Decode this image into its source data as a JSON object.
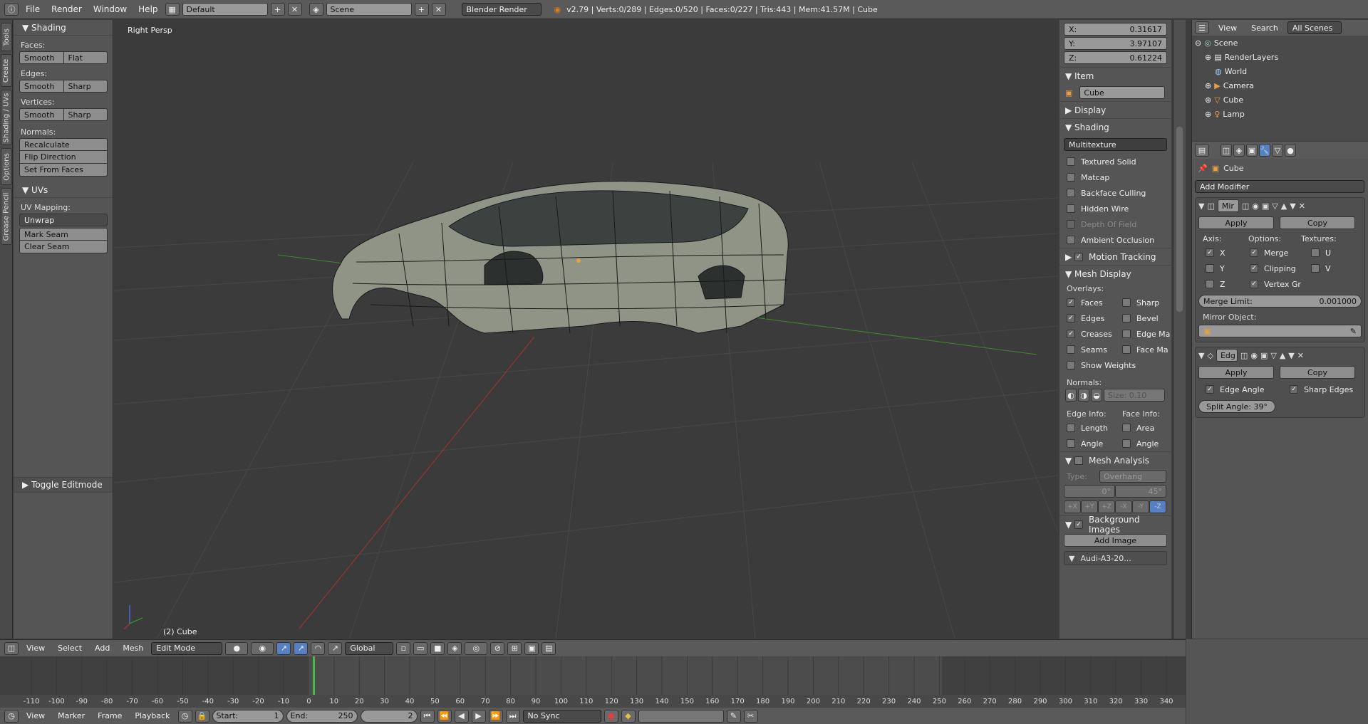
{
  "topbar": {
    "menus": [
      "File",
      "Render",
      "Window",
      "Help"
    ],
    "layout": "Default",
    "scene": "Scene",
    "engine": "Blender Render",
    "stats": "v2.79 | Verts:0/289 | Edges:0/520 | Faces:0/227 | Tris:443 | Mem:41.57M | Cube"
  },
  "tabs": [
    "Tools",
    "Create",
    "Shading / UVs",
    "Options",
    "Grease Pencil"
  ],
  "toolshelf": {
    "shading_title": "Shading",
    "faces_label": "Faces:",
    "faces_smooth": "Smooth",
    "faces_flat": "Flat",
    "edges_label": "Edges:",
    "edges_smooth": "Smooth",
    "edges_sharp": "Sharp",
    "vertices_label": "Vertices:",
    "vertices_smooth": "Smooth",
    "vertices_sharp": "Sharp",
    "normals_label": "Normals:",
    "recalculate": "Recalculate",
    "flip_direction": "Flip Direction",
    "set_from_faces": "Set From Faces",
    "uvs_title": "UVs",
    "uv_mapping_label": "UV Mapping:",
    "unwrap": "Unwrap",
    "mark_seam": "Mark Seam",
    "clear_seam": "Clear Seam",
    "toggle_editmode": "Toggle Editmode"
  },
  "viewport": {
    "view_name": "Right Persp",
    "object_label": "(2) Cube"
  },
  "npanel": {
    "x_label": "X:",
    "x_value": "0.31617",
    "y_label": "Y:",
    "y_value": "3.97107",
    "z_label": "Z:",
    "z_value": "0.61224",
    "item_title": "Item",
    "item_name": "Cube",
    "display_title": "Display",
    "shading_title": "Shading",
    "shading_mode": "Multitexture",
    "textured_solid": "Textured Solid",
    "matcap": "Matcap",
    "backface_culling": "Backface Culling",
    "hidden_wire": "Hidden Wire",
    "depth_of_field": "Depth Of Field",
    "ambient_occlusion": "Ambient Occlusion",
    "motion_tracking": "Motion Tracking",
    "mesh_display": "Mesh Display",
    "overlays_label": "Overlays:",
    "faces": "Faces",
    "sharp": "Sharp",
    "edges": "Edges",
    "bevel": "Bevel",
    "creases": "Creases",
    "edge_ma": "Edge Ma",
    "seams": "Seams",
    "face_ma": "Face Ma",
    "show_weights": "Show Weights",
    "normals_label": "Normals:",
    "size": "Size:  0.10",
    "edge_info": "Edge Info:",
    "face_info": "Face Info:",
    "length": "Length",
    "area": "Area",
    "angle_e": "Angle",
    "angle_f": "Angle",
    "mesh_analysis": "Mesh Analysis",
    "type_label": "Type:",
    "type_value": "Overhang",
    "deg_min": "0°",
    "deg_max": "45°",
    "axes": [
      "+X",
      "+Y",
      "+Z",
      "-X",
      "-Y",
      "-Z"
    ],
    "background_images": "Background Images",
    "add_image": "Add Image",
    "image_name": "Audi-A3-20..."
  },
  "outliner": {
    "menus": [
      "View",
      "Search"
    ],
    "filter": "All Scenes",
    "items": [
      "Scene",
      "RenderLayers",
      "World",
      "Camera",
      "Cube",
      "Lamp"
    ]
  },
  "props": {
    "object_name": "Cube",
    "add_modifier": "Add Modifier",
    "mirror_name": "Mir",
    "apply": "Apply",
    "copy": "Copy",
    "axis_label": "Axis:",
    "options_label": "Options:",
    "textures_label": "Textures:",
    "x": "X",
    "y": "Y",
    "z": "Z",
    "merge": "Merge",
    "clipping": "Clipping",
    "vertex_gr": "Vertex Gr",
    "u": "U",
    "v": "V",
    "merge_limit_label": "Merge Limit:",
    "merge_limit_value": "0.001000",
    "mirror_object": "Mirror Object:",
    "edge_name": "Edg",
    "apply2": "Apply",
    "copy2": "Copy",
    "edge_angle": "Edge Angle",
    "sharp_edges": "Sharp Edges",
    "split_angle": "Split Angle: 39°"
  },
  "vheader": {
    "menus": [
      "View",
      "Select",
      "Add",
      "Mesh"
    ],
    "mode": "Edit Mode",
    "orientation": "Global"
  },
  "timeline": {
    "ticks": [
      "-110",
      "-100",
      "-90",
      "-80",
      "-70",
      "-60",
      "-50",
      "-40",
      "-30",
      "-20",
      "-10",
      "0",
      "10",
      "20",
      "30",
      "40",
      "50",
      "60",
      "70",
      "80",
      "90",
      "100",
      "110",
      "120",
      "130",
      "140",
      "150",
      "160",
      "170",
      "180",
      "190",
      "200",
      "210",
      "220",
      "230",
      "240",
      "250",
      "260",
      "270",
      "280",
      "290",
      "300",
      "310",
      "320",
      "330",
      "340"
    ],
    "current_frame": 2,
    "menus": [
      "View",
      "Marker",
      "Frame",
      "Playback"
    ],
    "start_label": "Start:",
    "start_value": "1",
    "end_label": "End:",
    "end_value": "250",
    "frame_value": "2",
    "sync": "No Sync"
  },
  "colors": {
    "accent_blue": "#5680c2",
    "check_white": "#ffffff",
    "grid": "#454545",
    "x_axis": "#a33333",
    "y_axis": "#3e8a2a",
    "mesh": "#8f9487"
  }
}
